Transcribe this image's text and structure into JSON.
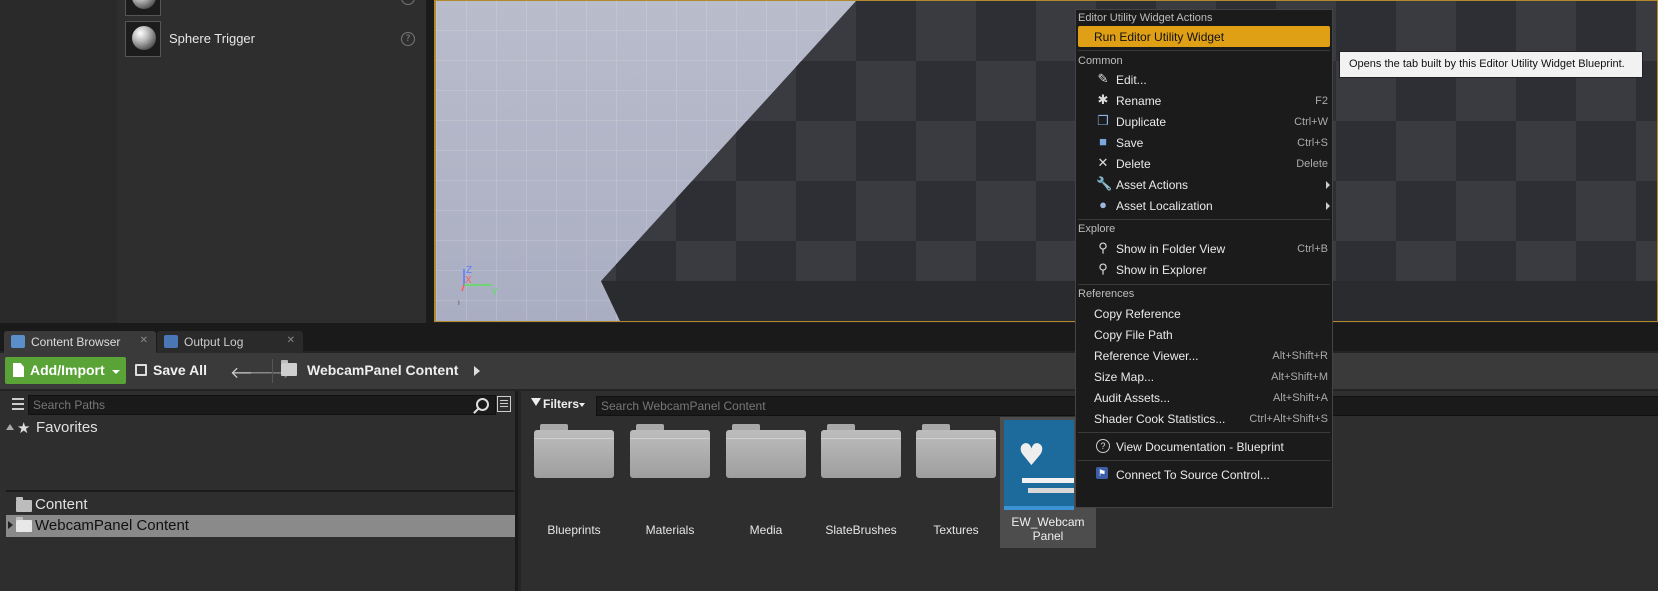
{
  "place_panel": {
    "items": [
      {
        "label": "Sphere Trigger"
      }
    ]
  },
  "viewport": {
    "axis": {
      "z": "Z",
      "x": "X",
      "y": "Y"
    }
  },
  "tabs": [
    {
      "label": "Content Browser"
    },
    {
      "label": "Output Log"
    }
  ],
  "toolbar": {
    "add_import": "Add/Import",
    "save_all": "Save All",
    "path": "WebcamPanel Content"
  },
  "sources": {
    "search_placeholder": "Search Paths",
    "favorites": "Favorites",
    "tree": [
      "Content",
      "WebcamPanel Content"
    ]
  },
  "assets": {
    "filters": "Filters",
    "search_placeholder": "Search WebcamPanel Content",
    "folders": [
      "Blueprints",
      "Materials",
      "Media",
      "SlateBrushes",
      "Textures"
    ],
    "selected_asset": {
      "line1": "EW_Webcam",
      "line2": "Panel"
    }
  },
  "context_menu": {
    "sections": {
      "ew_actions": "Editor Utility Widget Actions",
      "common": "Common",
      "explore": "Explore",
      "references": "References"
    },
    "run": "Run Editor Utility Widget",
    "common_items": [
      {
        "label": "Edit...",
        "shortcut": "",
        "icon": "pencil-icon"
      },
      {
        "label": "Rename",
        "shortcut": "F2",
        "icon": "rename-icon"
      },
      {
        "label": "Duplicate",
        "shortcut": "Ctrl+W",
        "icon": "duplicate-icon"
      },
      {
        "label": "Save",
        "shortcut": "Ctrl+S",
        "icon": "save-icon"
      },
      {
        "label": "Delete",
        "shortcut": "Delete",
        "icon": "delete-icon"
      },
      {
        "label": "Asset Actions",
        "shortcut": "",
        "icon": "wrench-icon"
      },
      {
        "label": "Asset Localization",
        "shortcut": "",
        "icon": "globe-icon"
      }
    ],
    "explore_items": [
      {
        "label": "Show in Folder View",
        "shortcut": "Ctrl+B"
      },
      {
        "label": "Show in Explorer",
        "shortcut": ""
      }
    ],
    "reference_items": [
      {
        "label": "Copy Reference",
        "shortcut": ""
      },
      {
        "label": "Copy File Path",
        "shortcut": ""
      },
      {
        "label": "Reference Viewer...",
        "shortcut": "Alt+Shift+R"
      },
      {
        "label": "Size Map...",
        "shortcut": "Alt+Shift+M"
      },
      {
        "label": "Audit Assets...",
        "shortcut": "Alt+Shift+A"
      },
      {
        "label": "Shader Cook Statistics...",
        "shortcut": "Ctrl+Alt+Shift+S"
      }
    ],
    "view_docs": "View Documentation - Blueprint",
    "connect_source": "Connect To Source Control..."
  },
  "tooltip": "Opens the tab built by this Editor Utility Widget Blueprint.",
  "colors": {
    "highlight": "#e0a016",
    "add_button": "#5aa337",
    "viewport_border": "#b38a2b"
  }
}
